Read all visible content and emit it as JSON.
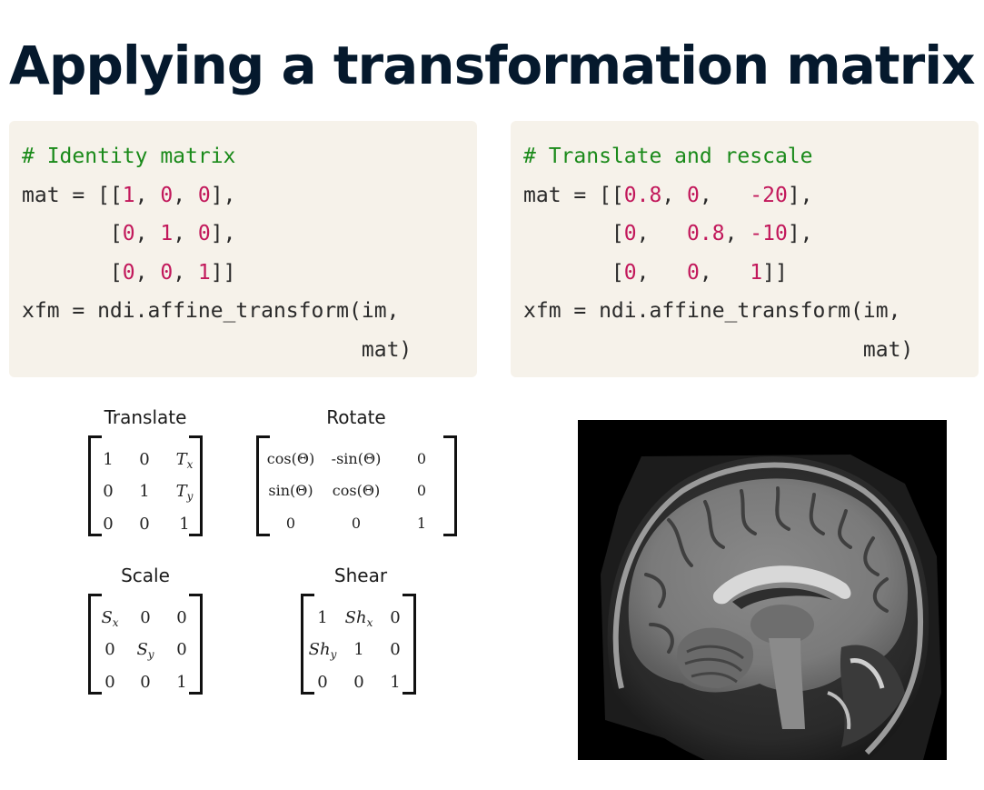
{
  "slide": {
    "title": "Applying a transformation matrix"
  },
  "code": {
    "left": [
      [
        {
          "t": "# Identity matrix",
          "k": "c"
        }
      ],
      [
        {
          "t": "mat = [[",
          "k": "t"
        },
        {
          "t": "1",
          "k": "n"
        },
        {
          "t": ", ",
          "k": "t"
        },
        {
          "t": "0",
          "k": "n"
        },
        {
          "t": ", ",
          "k": "t"
        },
        {
          "t": "0",
          "k": "n"
        },
        {
          "t": "],",
          "k": "t"
        }
      ],
      [
        {
          "t": "       [",
          "k": "t"
        },
        {
          "t": "0",
          "k": "n"
        },
        {
          "t": ", ",
          "k": "t"
        },
        {
          "t": "1",
          "k": "n"
        },
        {
          "t": ", ",
          "k": "t"
        },
        {
          "t": "0",
          "k": "n"
        },
        {
          "t": "],",
          "k": "t"
        }
      ],
      [
        {
          "t": "       [",
          "k": "t"
        },
        {
          "t": "0",
          "k": "n"
        },
        {
          "t": ", ",
          "k": "t"
        },
        {
          "t": "0",
          "k": "n"
        },
        {
          "t": ", ",
          "k": "t"
        },
        {
          "t": "1",
          "k": "n"
        },
        {
          "t": "]]",
          "k": "t"
        }
      ],
      [
        {
          "t": "xfm = ndi.affine_transform(im,",
          "k": "t"
        }
      ],
      [
        {
          "t": "                           mat)",
          "k": "t"
        }
      ]
    ],
    "right": [
      [
        {
          "t": "# Translate and rescale",
          "k": "c"
        }
      ],
      [
        {
          "t": "mat = [[",
          "k": "t"
        },
        {
          "t": "0.8",
          "k": "n"
        },
        {
          "t": ", ",
          "k": "t"
        },
        {
          "t": "0",
          "k": "n"
        },
        {
          "t": ",   ",
          "k": "t"
        },
        {
          "t": "-20",
          "k": "n"
        },
        {
          "t": "],",
          "k": "t"
        }
      ],
      [
        {
          "t": "       [",
          "k": "t"
        },
        {
          "t": "0",
          "k": "n"
        },
        {
          "t": ",   ",
          "k": "t"
        },
        {
          "t": "0.8",
          "k": "n"
        },
        {
          "t": ", ",
          "k": "t"
        },
        {
          "t": "-10",
          "k": "n"
        },
        {
          "t": "],",
          "k": "t"
        }
      ],
      [
        {
          "t": "       [",
          "k": "t"
        },
        {
          "t": "0",
          "k": "n"
        },
        {
          "t": ",   ",
          "k": "t"
        },
        {
          "t": "0",
          "k": "n"
        },
        {
          "t": ",   ",
          "k": "t"
        },
        {
          "t": "1",
          "k": "n"
        },
        {
          "t": "]]",
          "k": "t"
        }
      ],
      [
        {
          "t": "xfm = ndi.affine_transform(im,",
          "k": "t"
        }
      ],
      [
        {
          "t": "                           mat)",
          "k": "t"
        }
      ]
    ]
  },
  "matrices": {
    "translate": {
      "title": "Translate",
      "rows": [
        [
          "1",
          "0",
          "T|x"
        ],
        [
          "0",
          "1",
          "T|y"
        ],
        [
          "0",
          "0",
          "1"
        ]
      ]
    },
    "rotate": {
      "title": "Rotate",
      "rows": [
        [
          "cos(Θ)",
          "-sin(Θ)",
          "0"
        ],
        [
          "sin(Θ)",
          "cos(Θ)",
          "0"
        ],
        [
          "0",
          "0",
          "1"
        ]
      ]
    },
    "scale": {
      "title": "Scale",
      "rows": [
        [
          "S|x",
          "0",
          "0"
        ],
        [
          "0",
          "S|y",
          "0"
        ],
        [
          "0",
          "0",
          "1"
        ]
      ]
    },
    "shear": {
      "title": "Shear",
      "rows": [
        [
          "1",
          "Sh|x",
          "0"
        ],
        [
          "Sh|y",
          "1",
          "0"
        ],
        [
          "0",
          "0",
          "1"
        ]
      ]
    }
  },
  "image": {
    "subject": "sagittal-brain-mri"
  },
  "colors": {
    "title": "#05192d",
    "code_bg": "#f6f2ea",
    "comment": "#1a8a1a",
    "number": "#c2185b"
  }
}
